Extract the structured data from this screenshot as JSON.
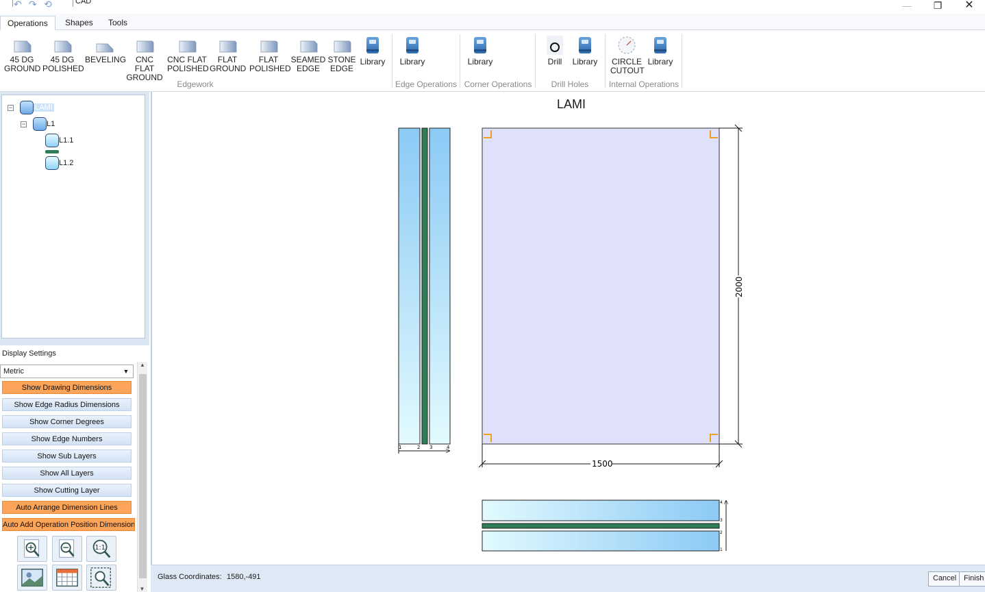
{
  "window": {
    "title": "CAD"
  },
  "tabs": [
    "Operations",
    "Shapes",
    "Tools"
  ],
  "ribbon": {
    "edgework": {
      "label": "Edgework",
      "buttons": [
        {
          "line1": "45 DG",
          "line2": "GROUND"
        },
        {
          "line1": "45 DG",
          "line2": "POLISHED"
        },
        {
          "line1": "BEVELING",
          "line2": ""
        },
        {
          "line1": "CNC FLAT",
          "line2": "GROUND"
        },
        {
          "line1": "CNC FLAT",
          "line2": "POLISHED"
        },
        {
          "line1": "FLAT",
          "line2": "GROUND"
        },
        {
          "line1": "FLAT",
          "line2": "POLISHED"
        },
        {
          "line1": "SEAMED",
          "line2": "EDGE"
        },
        {
          "line1": "STONE",
          "line2": "EDGE"
        },
        {
          "line1": "Library",
          "line2": ""
        }
      ]
    },
    "edge_operations": {
      "label": "Edge Operations",
      "library": "Library"
    },
    "corner_operations": {
      "label": "Corner Operations",
      "library": "Library"
    },
    "drill_holes": {
      "label": "Drill Holes",
      "drill": "Drill",
      "library": "Library"
    },
    "internal_operations": {
      "label": "Internal Operations",
      "circle_cutout_1": "CIRCLE",
      "circle_cutout_2": "CUTOUT",
      "library": "Library"
    }
  },
  "tree": {
    "root": "LAMI",
    "child": "L1",
    "leaves": [
      "L1.1",
      "L1.2"
    ]
  },
  "display_settings": {
    "title": "Display Settings",
    "units": "Metric",
    "toggles": [
      {
        "label": "Show Drawing Dimensions",
        "on": true
      },
      {
        "label": "Show Edge Radius Dimensions",
        "on": false
      },
      {
        "label": "Show Corner Degrees",
        "on": false
      },
      {
        "label": "Show Edge Numbers",
        "on": false
      },
      {
        "label": "Show Sub Layers",
        "on": false
      },
      {
        "label": "Show All Layers",
        "on": false
      },
      {
        "label": "Show Cutting Layer",
        "on": false
      },
      {
        "label": "Auto Arrange Dimension Lines",
        "on": true
      },
      {
        "label": "Auto Add Operation Position Dimension",
        "on": true
      }
    ]
  },
  "drawing": {
    "title": "LAMI",
    "width_dim": "1500",
    "height_dim": "2000",
    "side_edge_numbers": [
      "1",
      "2",
      "3",
      "4"
    ],
    "bottom_edge_numbers": [
      "4",
      "3",
      "2",
      "1"
    ]
  },
  "status": {
    "coord_label": "Glass Coordinates:",
    "coord_value": "1580,-491",
    "cancel": "Cancel",
    "finish": "Finish"
  },
  "colors": {
    "glass_face": "#dfe0fa",
    "interlayer": "#2e7d57",
    "glass_light": "#e2fafe",
    "glass_dark": "#8ccaf5",
    "corner_mark": "#f0a020",
    "toggle_on": "#fba45a"
  }
}
